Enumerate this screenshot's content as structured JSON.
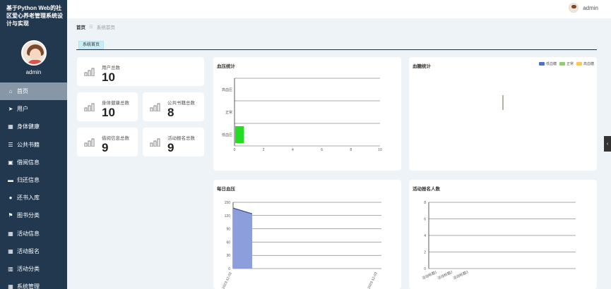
{
  "sidebar": {
    "system_title": "基于Python Web的社区爱心养老管理系统设计与实现",
    "admin_name": "admin",
    "items": [
      {
        "label": "首页",
        "icon": "home-icon",
        "glyph": "⌂",
        "active": true
      },
      {
        "label": "用户",
        "icon": "send-icon",
        "glyph": "➤"
      },
      {
        "label": "身体健康",
        "icon": "grid-icon",
        "glyph": "▦"
      },
      {
        "label": "公共书籍",
        "icon": "sliders-icon",
        "glyph": "☰"
      },
      {
        "label": "借阅信息",
        "icon": "clipboard-icon",
        "glyph": "▣"
      },
      {
        "label": "归还信息",
        "icon": "chat-icon",
        "glyph": "▬"
      },
      {
        "label": "还书入库",
        "icon": "location-icon",
        "glyph": "●"
      },
      {
        "label": "图书分类",
        "icon": "flag-icon",
        "glyph": "⚑"
      },
      {
        "label": "活动信息",
        "icon": "grid-icon",
        "glyph": "▦"
      },
      {
        "label": "活动报名",
        "icon": "grid-icon",
        "glyph": "▦"
      },
      {
        "label": "活动分类",
        "icon": "book-icon",
        "glyph": "▥"
      },
      {
        "label": "系统管理",
        "icon": "grid-icon",
        "glyph": "▦"
      }
    ]
  },
  "topbar": {
    "username": "admin"
  },
  "breadcrumb": {
    "home": "首页",
    "separator": "☰",
    "current": "系统首页"
  },
  "tabs": [
    {
      "label": "系统首页"
    }
  ],
  "stats": [
    {
      "label": "用户总数",
      "value": "10"
    },
    {
      "label": "身体健康总数",
      "value": "10"
    },
    {
      "label": "公共书籍总数",
      "value": "8"
    },
    {
      "label": "借阅信息总数",
      "value": "9"
    },
    {
      "label": "活动报名总数",
      "value": "9"
    }
  ],
  "chart_data": [
    {
      "type": "bar",
      "title": "血压统计",
      "categories": [
        "低血压",
        "正常",
        "高血压"
      ],
      "orientation": "horizontal",
      "x_ticks": [
        "0",
        "2",
        "4",
        "6",
        "8",
        "10"
      ],
      "xlim": [
        0,
        10
      ],
      "values": [
        0.2,
        0,
        0
      ],
      "color": "#22dd22",
      "grid": true
    },
    {
      "type": "bar",
      "title": "血糖统计",
      "legend": [
        "低血糖",
        "正常",
        "高血糖"
      ],
      "legend_colors": [
        "#5470c6",
        "#91cc75",
        "#fac858"
      ],
      "legend_position": "top-right"
    },
    {
      "type": "area",
      "title": "每日血压",
      "y_ticks": [
        "0",
        "30",
        "60",
        "90",
        "120",
        "150"
      ],
      "ylim": [
        0,
        150
      ],
      "x_labels": [
        "2023-12-02",
        "2023-12-03"
      ],
      "values": [
        137,
        124
      ],
      "color": "#5470c6",
      "fill": "#8c9edb",
      "grid": true
    },
    {
      "type": "bar",
      "title": "活动报名人数",
      "y_ticks": [
        "0",
        "2",
        "4",
        "6",
        "8"
      ],
      "ylim": [
        0,
        8
      ],
      "categories": [
        "活动标题1",
        "活动标题2",
        "活动标题3"
      ],
      "values": [
        0,
        0,
        0
      ],
      "grid": true
    }
  ]
}
